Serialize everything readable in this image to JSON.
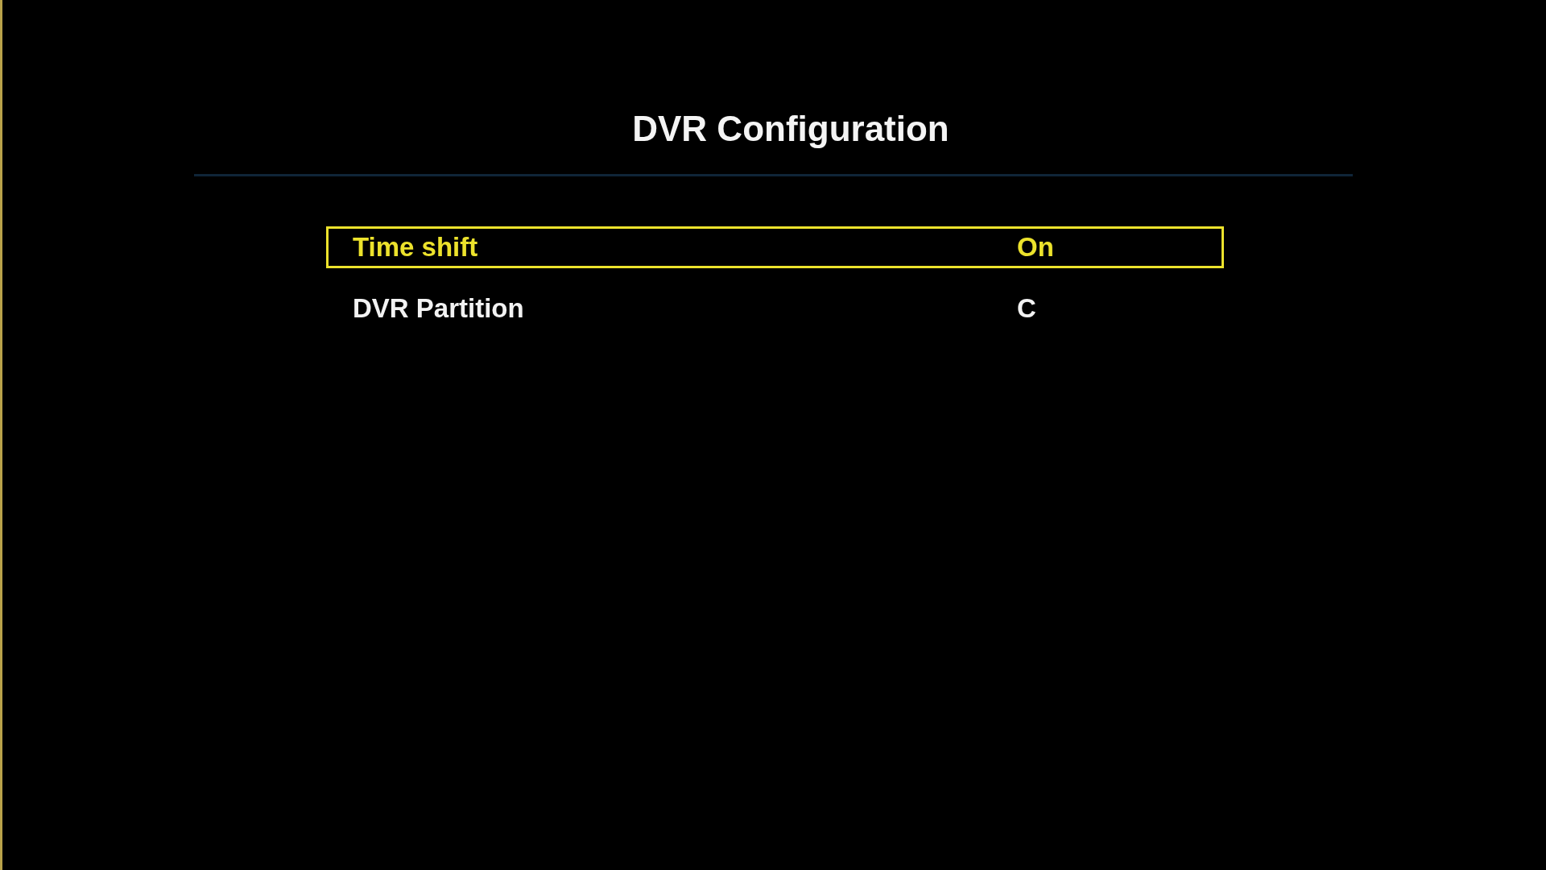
{
  "title": "DVR Configuration",
  "items": [
    {
      "label": "Time shift",
      "value": "On",
      "selected": true
    },
    {
      "label": "DVR Partition",
      "value": "C",
      "selected": false
    }
  ]
}
